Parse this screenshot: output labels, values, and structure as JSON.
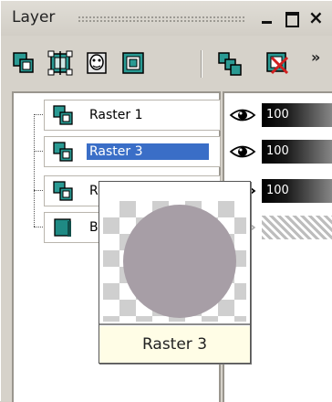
{
  "window": {
    "title": "Layer",
    "controls": {
      "minimize": "minimize",
      "maximize": "maximize",
      "close": "×"
    }
  },
  "toolbar": {
    "tools": [
      "new-raster-layer-icon",
      "new-vector-layer-icon",
      "new-mask-layer-icon",
      "new-adjustment-layer-icon",
      "duplicate-layer-icon",
      "delete-layer-icon"
    ],
    "overflow": "»"
  },
  "layers": [
    {
      "name": "Raster 1",
      "selected": false,
      "opacity": "100",
      "visible": true
    },
    {
      "name": "Raster 3",
      "selected": true,
      "opacity": "100",
      "visible": true
    },
    {
      "name": "Ra",
      "selected": false,
      "opacity": "100",
      "visible": true
    },
    {
      "name": "Ba",
      "selected": false,
      "opacity": "",
      "visible": false
    }
  ],
  "tooltip": {
    "caption": "Raster 3"
  },
  "colors": {
    "selection": "#3a6ec7",
    "layer_icon": "#2a9a93",
    "thumbnail_circle": "#a79ea6",
    "tooltip_caption_bg": "#fffde6"
  }
}
